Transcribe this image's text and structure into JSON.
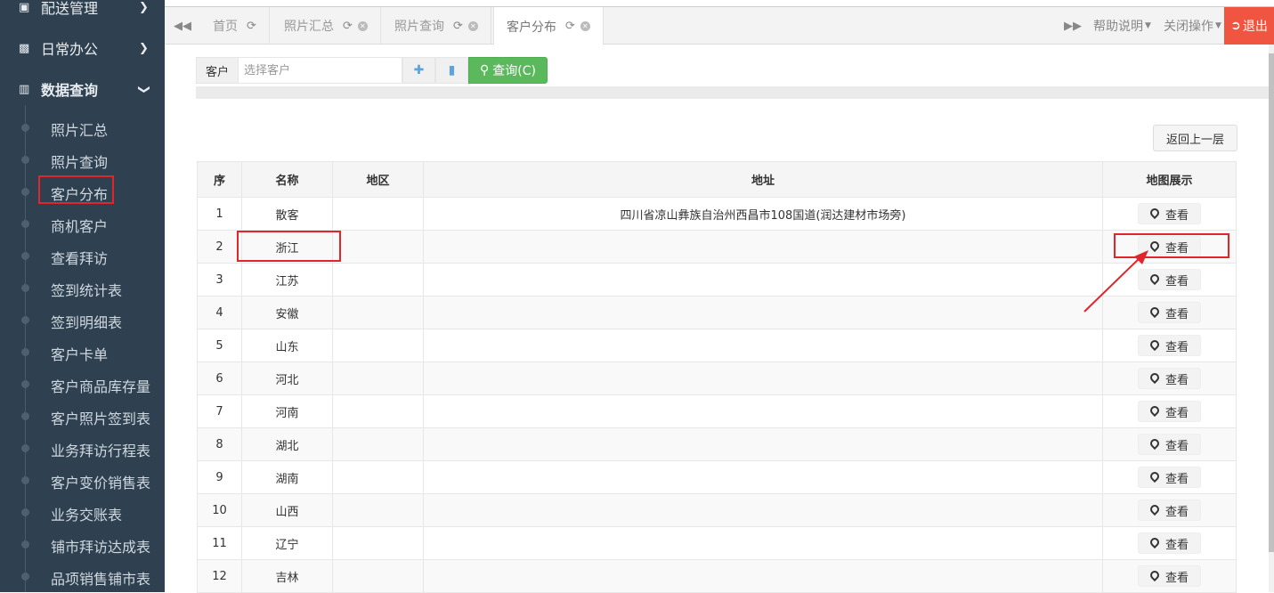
{
  "sidebar": {
    "groups": [
      {
        "label": "配送管理",
        "icon": "car-icon"
      },
      {
        "label": "日常办公",
        "icon": "briefcase-icon"
      },
      {
        "label": "数据查询",
        "icon": "bar-chart-icon"
      }
    ],
    "items": [
      {
        "label": "照片汇总"
      },
      {
        "label": "照片查询"
      },
      {
        "label": "客户分布"
      },
      {
        "label": "商机客户"
      },
      {
        "label": "查看拜访"
      },
      {
        "label": "签到统计表"
      },
      {
        "label": "签到明细表"
      },
      {
        "label": "客户卡单"
      },
      {
        "label": "客户商品库存量"
      },
      {
        "label": "客户照片签到表"
      },
      {
        "label": "业务拜访行程表"
      },
      {
        "label": "客户变价销售表"
      },
      {
        "label": "业务交账表"
      },
      {
        "label": "铺市拜访达成表"
      },
      {
        "label": "品项销售铺市表"
      }
    ],
    "active_item": "客户分布"
  },
  "tabs": [
    {
      "label": "首页"
    },
    {
      "label": "照片汇总"
    },
    {
      "label": "照片查询"
    },
    {
      "label": "客户分布"
    }
  ],
  "header": {
    "help_label": "帮助说明",
    "close_label": "关闭操作",
    "logout_label": "退出"
  },
  "toolbar": {
    "customer_label": "客户",
    "customer_placeholder": "选择客户",
    "query_label": "查询(C)"
  },
  "back_label": "返回上一层",
  "table": {
    "headers": [
      "序",
      "名称",
      "地区",
      "地址",
      "地图展示"
    ],
    "view_label": "查看",
    "rows": [
      {
        "no": "1",
        "name": "散客",
        "region": "",
        "address": "四川省凉山彝族自治州西昌市108国道(润达建材市场旁)"
      },
      {
        "no": "2",
        "name": "浙江",
        "region": "",
        "address": ""
      },
      {
        "no": "3",
        "name": "江苏",
        "region": "",
        "address": ""
      },
      {
        "no": "4",
        "name": "安徽",
        "region": "",
        "address": ""
      },
      {
        "no": "5",
        "name": "山东",
        "region": "",
        "address": ""
      },
      {
        "no": "6",
        "name": "河北",
        "region": "",
        "address": ""
      },
      {
        "no": "7",
        "name": "河南",
        "region": "",
        "address": ""
      },
      {
        "no": "8",
        "name": "湖北",
        "region": "",
        "address": ""
      },
      {
        "no": "9",
        "name": "湖南",
        "region": "",
        "address": ""
      },
      {
        "no": "10",
        "name": "山西",
        "region": "",
        "address": ""
      },
      {
        "no": "11",
        "name": "辽宁",
        "region": "",
        "address": ""
      },
      {
        "no": "12",
        "name": "吉林",
        "region": "",
        "address": ""
      }
    ]
  },
  "colors": {
    "sidebar_bg": "#2f4050",
    "highlight": "#e0262b",
    "query_btn": "#5cb85c",
    "logout_bg": "#f05542"
  }
}
